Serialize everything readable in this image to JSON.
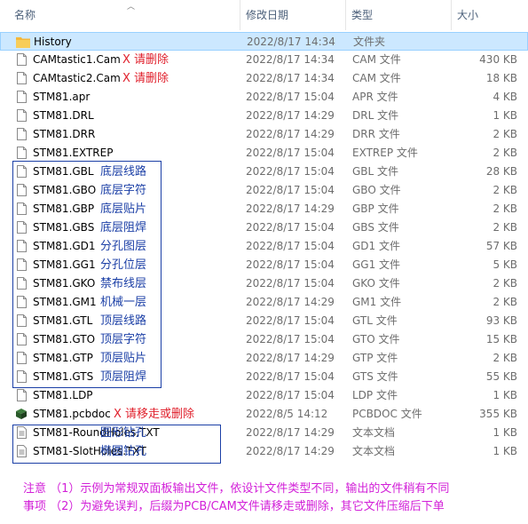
{
  "columns": {
    "name": "名称",
    "date": "修改日期",
    "type": "类型",
    "size": "大小"
  },
  "files": [
    {
      "name": "History",
      "date": "2022/8/17 14:34",
      "type": "文件夹",
      "size": "",
      "icon": "folder-icon",
      "note": ""
    },
    {
      "name": "CAMtastic1.Cam",
      "date": "2022/8/17 14:34",
      "type": "CAM 文件",
      "size": "430 KB",
      "icon": "file-icon",
      "note": "X 请删除"
    },
    {
      "name": "CAMtastic2.Cam",
      "date": "2022/8/17 14:34",
      "type": "CAM 文件",
      "size": "18 KB",
      "icon": "file-icon",
      "note": "X 请删除"
    },
    {
      "name": "STM81.apr",
      "date": "2022/8/17 15:04",
      "type": "APR 文件",
      "size": "4 KB",
      "icon": "file-icon",
      "note": ""
    },
    {
      "name": "STM81.DRL",
      "date": "2022/8/17 14:29",
      "type": "DRL 文件",
      "size": "1 KB",
      "icon": "file-icon",
      "note": ""
    },
    {
      "name": "STM81.DRR",
      "date": "2022/8/17 14:29",
      "type": "DRR 文件",
      "size": "2 KB",
      "icon": "file-icon",
      "note": ""
    },
    {
      "name": "STM81.EXTREP",
      "date": "2022/8/17 15:04",
      "type": "EXTREP 文件",
      "size": "2 KB",
      "icon": "file-icon",
      "note": ""
    },
    {
      "name": "STM81.GBL",
      "date": "2022/8/17 15:04",
      "type": "GBL 文件",
      "size": "28 KB",
      "icon": "file-icon",
      "note": "底层线路"
    },
    {
      "name": "STM81.GBO",
      "date": "2022/8/17 15:04",
      "type": "GBO 文件",
      "size": "2 KB",
      "icon": "file-icon",
      "note": "底层字符"
    },
    {
      "name": "STM81.GBP",
      "date": "2022/8/17 14:29",
      "type": "GBP 文件",
      "size": "2 KB",
      "icon": "file-icon",
      "note": "底层贴片"
    },
    {
      "name": "STM81.GBS",
      "date": "2022/8/17 15:04",
      "type": "GBS 文件",
      "size": "2 KB",
      "icon": "file-icon",
      "note": "底层阻焊"
    },
    {
      "name": "STM81.GD1",
      "date": "2022/8/17 15:04",
      "type": "GD1 文件",
      "size": "57 KB",
      "icon": "file-icon",
      "note": "分孔图层"
    },
    {
      "name": "STM81.GG1",
      "date": "2022/8/17 15:04",
      "type": "GG1 文件",
      "size": "5 KB",
      "icon": "file-icon",
      "note": "分孔位层"
    },
    {
      "name": "STM81.GKO",
      "date": "2022/8/17 15:04",
      "type": "GKO 文件",
      "size": "2 KB",
      "icon": "file-icon",
      "note": "禁布线层"
    },
    {
      "name": "STM81.GM1",
      "date": "2022/8/17 14:29",
      "type": "GM1 文件",
      "size": "2 KB",
      "icon": "file-icon",
      "note": "机械一层"
    },
    {
      "name": "STM81.GTL",
      "date": "2022/8/17 15:04",
      "type": "GTL 文件",
      "size": "93 KB",
      "icon": "file-icon",
      "note": "顶层线路"
    },
    {
      "name": "STM81.GTO",
      "date": "2022/8/17 15:04",
      "type": "GTO 文件",
      "size": "15 KB",
      "icon": "file-icon",
      "note": "顶层字符"
    },
    {
      "name": "STM81.GTP",
      "date": "2022/8/17 14:29",
      "type": "GTP 文件",
      "size": "2 KB",
      "icon": "file-icon",
      "note": "顶层贴片"
    },
    {
      "name": "STM81.GTS",
      "date": "2022/8/17 15:04",
      "type": "GTS 文件",
      "size": "55 KB",
      "icon": "file-icon",
      "note": "顶层阻焊"
    },
    {
      "name": "STM81.LDP",
      "date": "2022/8/17 15:04",
      "type": "LDP 文件",
      "size": "1 KB",
      "icon": "file-icon",
      "note": ""
    },
    {
      "name": "STM81.pcbdoc",
      "date": "2022/8/5 14:12",
      "type": "PCBDOC 文件",
      "size": "355 KB",
      "icon": "pcbdoc-icon",
      "note": "X 请移走或删除"
    },
    {
      "name": "STM81-RoundHoles.TXT",
      "date": "2022/8/17 14:29",
      "type": "文本文档",
      "size": "1 KB",
      "icon": "text-file-icon",
      "note": "圆形钻孔"
    },
    {
      "name": "STM81-SlotHoles.TXT",
      "date": "2022/8/17 14:29",
      "type": "文本文档",
      "size": "1 KB",
      "icon": "text-file-icon",
      "note": "椭圆钻孔"
    }
  ],
  "footer": {
    "line1": "注意  （1）示例为常规双面板输出文件，依设计文件类型不同，输出的文件稍有不同",
    "line2": "事项  （2）为避免误判，后缀为PCB/CAM文件请移走或删除，其它文件压缩后下单"
  },
  "colors": {
    "selection": "#cce8ff",
    "delete_note": "#e0202c",
    "layer_note": "#1b3fa6",
    "footer": "#d21fd8",
    "folder": "#f8c74b"
  }
}
